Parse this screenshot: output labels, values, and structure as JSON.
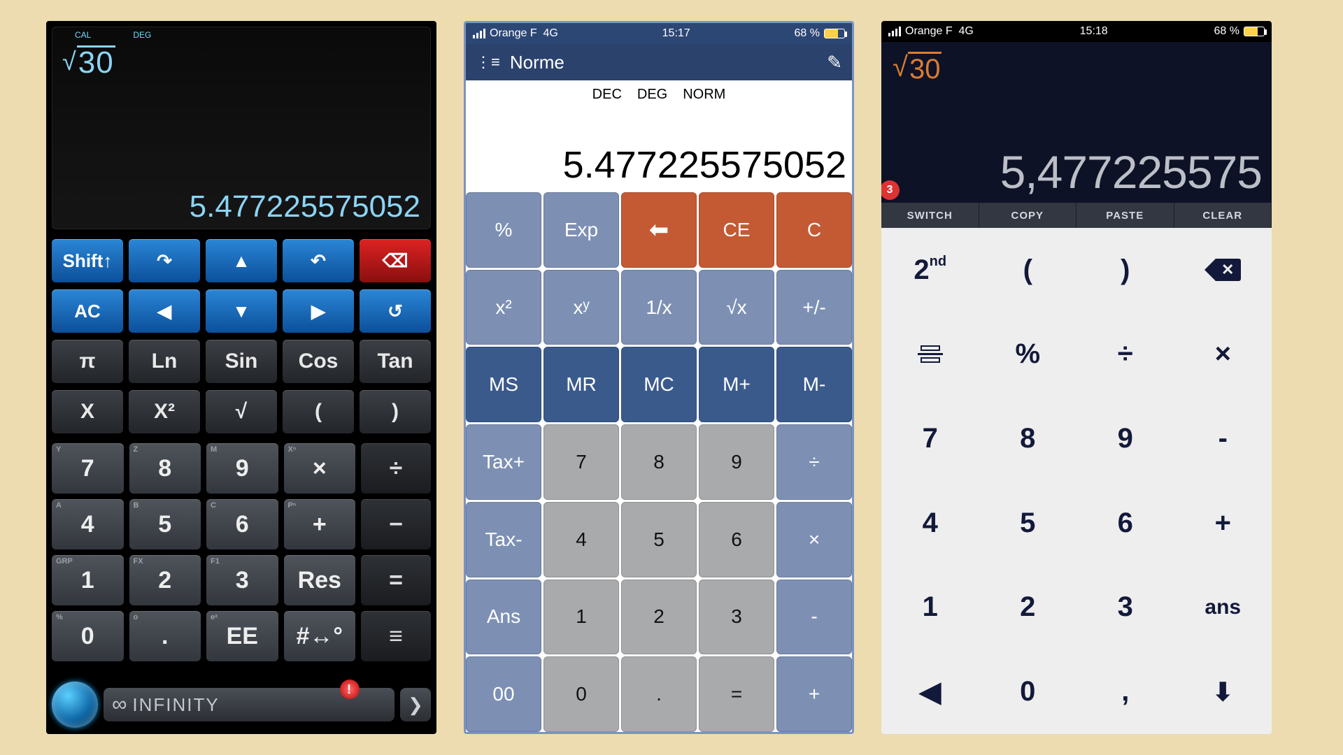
{
  "calc1": {
    "modes": [
      "CAL",
      "DEG"
    ],
    "input": "30",
    "result": "5.477225575052",
    "rows_blue1": [
      "Shift↑",
      "↷",
      "▲",
      "↶",
      "⌫"
    ],
    "rows_blue2": [
      "AC",
      "◀",
      "▼",
      "▶",
      "↺"
    ],
    "rows_dark1": [
      "π",
      "Ln",
      "Sin",
      "Cos",
      "Tan"
    ],
    "rows_dark2": [
      "X",
      "X²",
      "√",
      "(",
      ")"
    ],
    "num1": {
      "cells": [
        "7",
        "8",
        "9",
        "×"
      ],
      "corners": [
        "Y",
        "Z",
        "M",
        "Xⁿ"
      ],
      "op": "÷"
    },
    "num2": {
      "cells": [
        "4",
        "5",
        "6",
        "+"
      ],
      "corners": [
        "A",
        "B",
        "C",
        "Pⁿ"
      ],
      "op": "−"
    },
    "num3": {
      "cells": [
        "1",
        "2",
        "3",
        "Res"
      ],
      "corners": [
        "GRP",
        "FX",
        "F1",
        ""
      ],
      "op": "="
    },
    "num4": {
      "cells": [
        "0",
        ".",
        "EE",
        "#↔°"
      ],
      "corners": [
        "%",
        "o",
        "eˣ",
        ""
      ],
      "op": "≡"
    },
    "footer": {
      "label": "INFINITY",
      "badge": "!"
    }
  },
  "calc2": {
    "status": {
      "carrier": "Orange F",
      "net": "4G",
      "time": "15:17",
      "batt": "68 %"
    },
    "title": "Norme",
    "modes": [
      "DEC",
      "DEG",
      "NORM"
    ],
    "display": "5.477225575052",
    "keys": [
      [
        "%",
        "Exp",
        "←",
        "CE",
        "C"
      ],
      [
        "x²",
        "xʸ",
        "1/x",
        "√x",
        "+/-"
      ],
      [
        "MS",
        "MR",
        "MC",
        "M+",
        "M-"
      ],
      [
        "Tax+",
        "7",
        "8",
        "9",
        "÷"
      ],
      [
        "Tax-",
        "4",
        "5",
        "6",
        "×"
      ],
      [
        "Ans",
        "1",
        "2",
        "3",
        "-"
      ],
      [
        "00",
        "0",
        ".",
        "=",
        "+"
      ]
    ],
    "styles": [
      [
        "l",
        "l",
        "o",
        "o",
        "o"
      ],
      [
        "l",
        "l",
        "l",
        "l",
        "l"
      ],
      [
        "d",
        "d",
        "d",
        "d",
        "d"
      ],
      [
        "l",
        "g",
        "g",
        "g",
        "l"
      ],
      [
        "l",
        "g",
        "g",
        "g",
        "l"
      ],
      [
        "l",
        "g",
        "g",
        "g",
        "l"
      ],
      [
        "l",
        "g",
        "g",
        "g",
        "l"
      ]
    ]
  },
  "calc3": {
    "status": {
      "carrier": "Orange F",
      "net": "4G",
      "time": "15:18",
      "batt": "68 %"
    },
    "input": "30",
    "result": "5,477225575",
    "badge": "3",
    "actions": [
      "SWITCH",
      "COPY",
      "PASTE",
      "CLEAR"
    ],
    "keys": [
      [
        "2nd",
        "(",
        ")",
        "⌫"
      ],
      [
        "frac",
        "%",
        "÷",
        "×"
      ],
      [
        "7",
        "8",
        "9",
        "-"
      ],
      [
        "4",
        "5",
        "6",
        "+"
      ],
      [
        "1",
        "2",
        "3",
        "ans"
      ],
      [
        "◀",
        "0",
        ",",
        "↓"
      ]
    ]
  }
}
